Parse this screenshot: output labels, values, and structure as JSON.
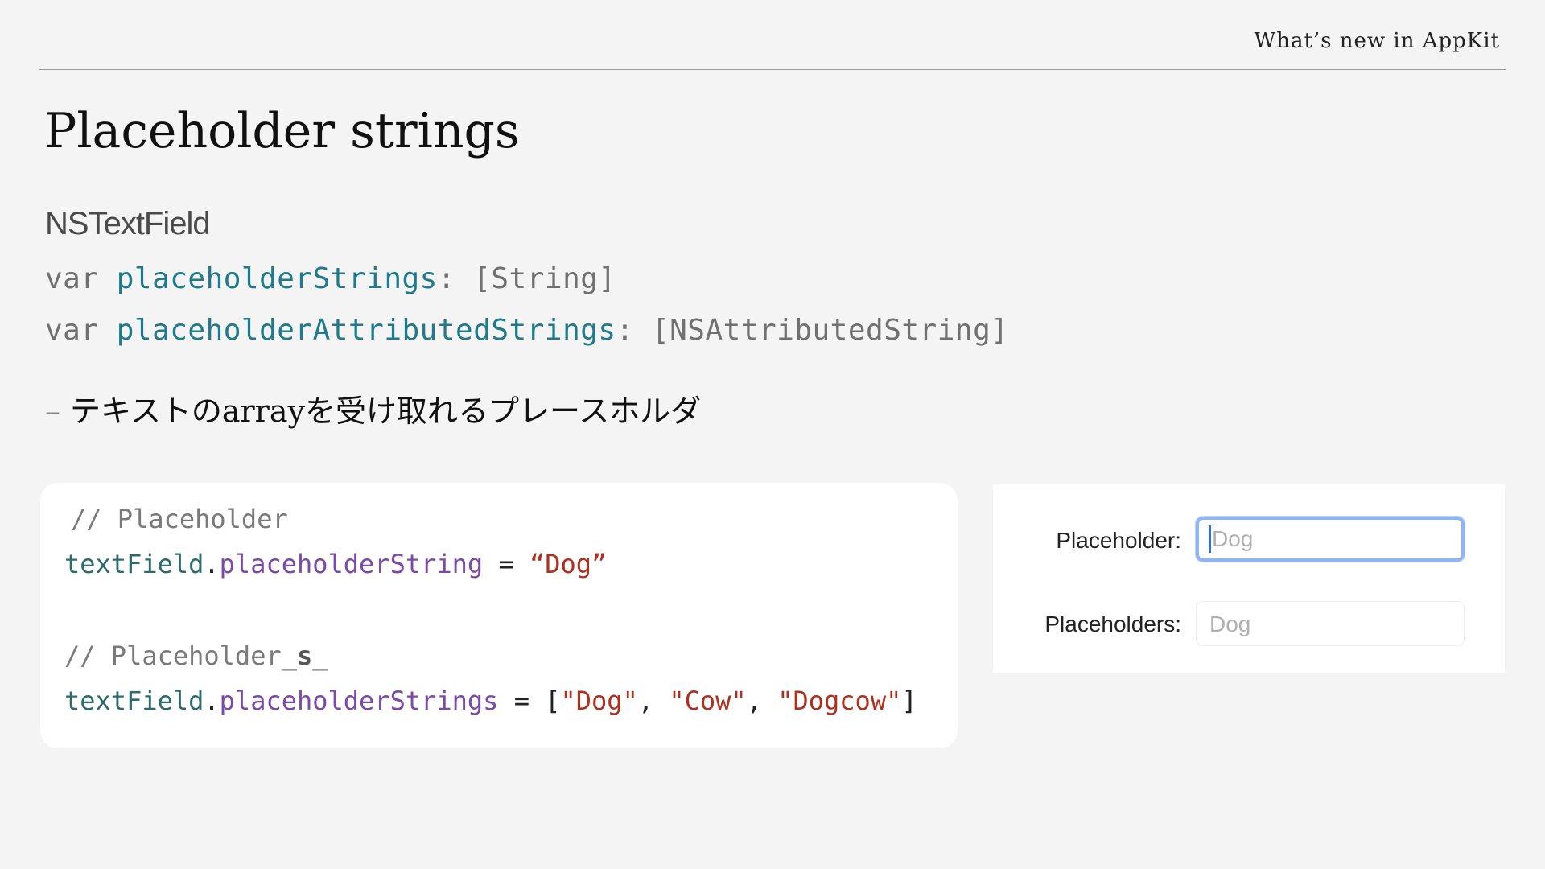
{
  "header": {
    "title": "What’s new in AppKit"
  },
  "slide": {
    "title": "Placeholder strings",
    "class_name": "NSTextField",
    "declarations": [
      {
        "keyword": "var",
        "name": "placeholderStrings",
        "type": ": [String]"
      },
      {
        "keyword": "var",
        "name": "placeholderAttributedStrings",
        "type": ": [NSAttributedString]"
      }
    ],
    "bullet": {
      "dash": "–",
      "text": "テキストのarrayを受け取れるプレースホルダ"
    }
  },
  "code": {
    "comment1": "// Placeholder",
    "line1": {
      "object": "textField",
      "dot": ".",
      "member": "placeholderString",
      "op": " = ",
      "value": "“Dog”"
    },
    "comment2_prefix": "// Placeholder_",
    "comment2_bold": "s",
    "comment2_suffix": "_",
    "line2": {
      "object": "textField",
      "dot": ".",
      "member": "placeholderStrings",
      "op": " = ",
      "open": "[",
      "v1": "\"Dog\"",
      "sep1": ", ",
      "v2": "\"Cow\"",
      "sep2": ", ",
      "v3": "\"Dogcow\"",
      "close": "]"
    }
  },
  "preview": {
    "field1": {
      "label": "Placeholder:",
      "placeholder": "Dog"
    },
    "field2": {
      "label": "Placeholders:",
      "placeholder": "Dog"
    }
  },
  "colors": {
    "background": "#f4f4f4",
    "property": "#1f7a8c",
    "member": "#7a4aa8",
    "string": "#b03020",
    "focus_ring": "#8fb6f2"
  }
}
